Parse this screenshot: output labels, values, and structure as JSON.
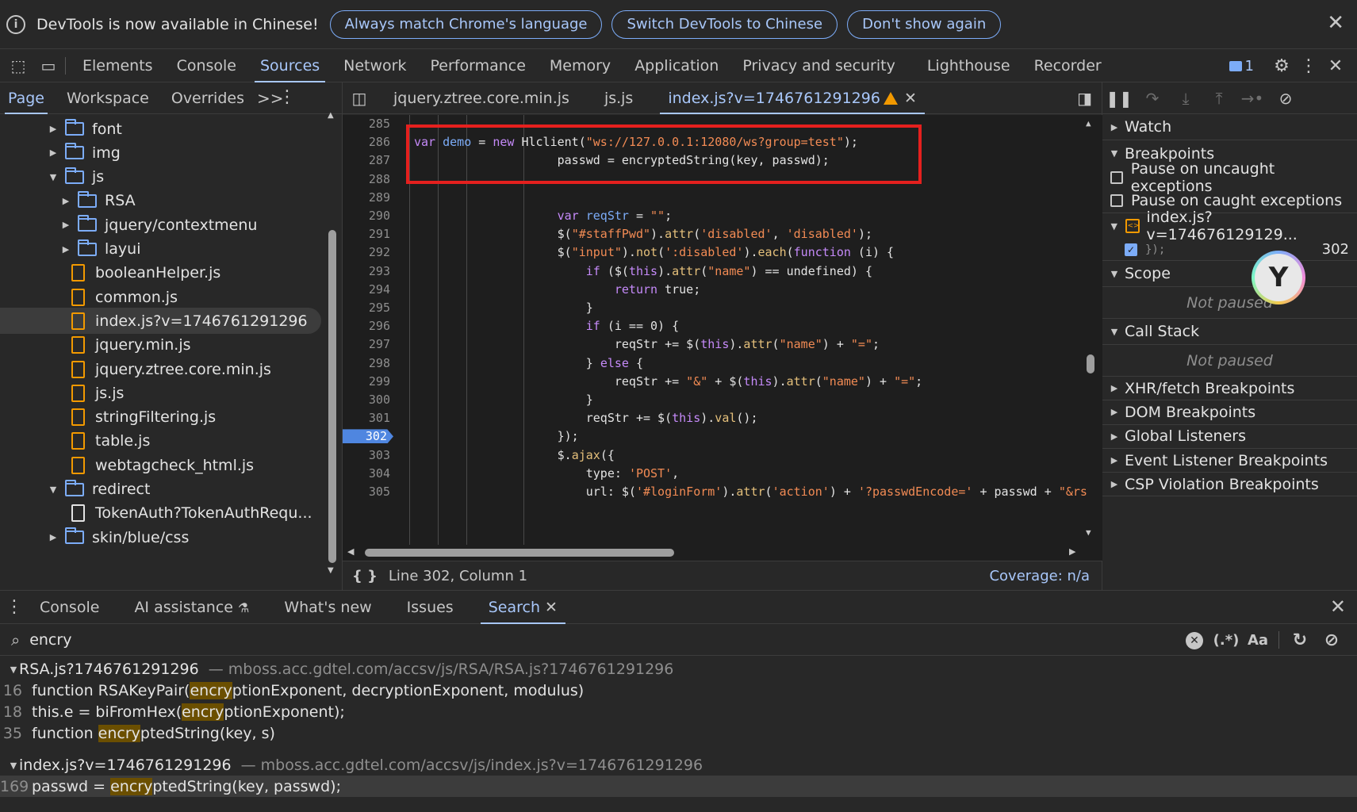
{
  "infobar": {
    "text": "DevTools is now available in Chinese!",
    "btn_match": "Always match Chrome's language",
    "btn_switch": "Switch DevTools to Chinese",
    "btn_dont": "Don't show again"
  },
  "toolbar": {
    "tabs": [
      "Elements",
      "Console",
      "Sources",
      "Network",
      "Performance",
      "Memory",
      "Application",
      "Privacy and security",
      "Lighthouse",
      "Recorder"
    ],
    "active_tab": "Sources",
    "issues_count": "1"
  },
  "navigator": {
    "tabs": [
      "Page",
      "Workspace",
      "Overrides"
    ],
    "more": ">>",
    "tree": [
      {
        "label": "font",
        "type": "folder",
        "depth": 1,
        "open": false
      },
      {
        "label": "img",
        "type": "folder",
        "depth": 1,
        "open": false
      },
      {
        "label": "js",
        "type": "folder",
        "depth": 1,
        "open": true
      },
      {
        "label": "RSA",
        "type": "folder",
        "depth": 2,
        "open": false
      },
      {
        "label": "jquery/contextmenu",
        "type": "folder",
        "depth": 2,
        "open": false
      },
      {
        "label": "layui",
        "type": "folder",
        "depth": 2,
        "open": false
      },
      {
        "label": "booleanHelper.js",
        "type": "file",
        "depth": 2
      },
      {
        "label": "common.js",
        "type": "file",
        "depth": 2
      },
      {
        "label": "index.js?v=1746761291296",
        "type": "file",
        "depth": 2,
        "selected": true
      },
      {
        "label": "jquery.min.js",
        "type": "file",
        "depth": 2
      },
      {
        "label": "jquery.ztree.core.min.js",
        "type": "file",
        "depth": 2
      },
      {
        "label": "js.js",
        "type": "file",
        "depth": 2
      },
      {
        "label": "stringFiltering.js",
        "type": "file",
        "depth": 2
      },
      {
        "label": "table.js",
        "type": "file",
        "depth": 2
      },
      {
        "label": "webtagcheck_html.js",
        "type": "file",
        "depth": 2
      },
      {
        "label": "redirect",
        "type": "folder",
        "depth": 1,
        "open": true
      },
      {
        "label": "TokenAuth?TokenAuthRequ...",
        "type": "doc",
        "depth": 2
      },
      {
        "label": "skin/blue/css",
        "type": "folder",
        "depth": 1,
        "open": false
      }
    ]
  },
  "editor": {
    "tabs": [
      "jquery.ztree.core.min.js",
      "js.js",
      "index.js?v=1746761291296"
    ],
    "active_tab": "index.js?v=1746761291296",
    "breakpoint_line": "302",
    "lines": [
      {
        "n": "285",
        "html": ""
      },
      {
        "n": "286",
        "html": "<span class=\"kw\">var</span> <span class=\"vr\">demo</span> = <span class=\"kw\">new</span> Hlclient(<span class=\"str\">\"ws://127.0.0.1:12080/ws?group=test\"</span>);"
      },
      {
        "n": "287",
        "html": "                    passwd = encryptedString(key, passwd);"
      },
      {
        "n": "288",
        "html": ""
      },
      {
        "n": "289",
        "html": ""
      },
      {
        "n": "290",
        "html": "                    <span class=\"kw\">var</span> <span class=\"vr\">reqStr</span> = <span class=\"str\">\"\"</span>;"
      },
      {
        "n": "291",
        "html": "                    $(<span class=\"str\">\"#staffPwd\"</span>).<span class=\"fn\">attr</span>(<span class=\"str\">'disabled'</span>, <span class=\"str\">'disabled'</span>);"
      },
      {
        "n": "292",
        "html": "                    $(<span class=\"str\">\"input\"</span>).<span class=\"fn\">not</span>(<span class=\"str\">':disabled'</span>).<span class=\"fn\">each</span>(<span class=\"kw\">function</span> (i) {"
      },
      {
        "n": "293",
        "html": "                        <span class=\"kw\">if</span> ($(<span class=\"th\">this</span>).<span class=\"fn\">attr</span>(<span class=\"str\">\"name\"</span>) == undefined) {"
      },
      {
        "n": "294",
        "html": "                            <span class=\"kw\">return</span> true;"
      },
      {
        "n": "295",
        "html": "                        }"
      },
      {
        "n": "296",
        "html": "                        <span class=\"kw\">if</span> (i == 0) {"
      },
      {
        "n": "297",
        "html": "                            reqStr += $(<span class=\"th\">this</span>).<span class=\"fn\">attr</span>(<span class=\"str\">\"name\"</span>) + <span class=\"str\">\"=\"</span>;"
      },
      {
        "n": "298",
        "html": "                        } <span class=\"kw\">else</span> {"
      },
      {
        "n": "299",
        "html": "                            reqStr += <span class=\"str\">\"&amp;\"</span> + $(<span class=\"th\">this</span>).<span class=\"fn\">attr</span>(<span class=\"str\">\"name\"</span>) + <span class=\"str\">\"=\"</span>;"
      },
      {
        "n": "300",
        "html": "                        }"
      },
      {
        "n": "301",
        "html": "                        reqStr += $(<span class=\"th\">this</span>).<span class=\"fn\">val</span>();"
      },
      {
        "n": "302",
        "html": "                    });"
      },
      {
        "n": "303",
        "html": "                    $.<span class=\"fn\">ajax</span>({"
      },
      {
        "n": "304",
        "html": "                        type: <span class=\"str\">'POST'</span>,"
      },
      {
        "n": "305",
        "html": "                        url: $(<span class=\"str\">'#loginForm'</span>).<span class=\"fn\">attr</span>(<span class=\"str\">'action'</span>) + <span class=\"str\">'?passwdEncode='</span> + passwd + <span class=\"str\">\"&amp;rs</span>"
      }
    ],
    "status_position": "Line 302, Column 1",
    "coverage": "Coverage: n/a"
  },
  "debugger": {
    "watch": "Watch",
    "breakpoints": "Breakpoints",
    "pause_uncaught": "Pause on uncaught exceptions",
    "pause_caught": "Pause on caught exceptions",
    "bp_file": "index.js?v=174676129129...",
    "bp_code": "});",
    "bp_line": "302",
    "scope": "Scope",
    "scope_state": "Not paused",
    "callstack": "Call Stack",
    "callstack_state": "Not paused",
    "sections": [
      "XHR/fetch Breakpoints",
      "DOM Breakpoints",
      "Global Listeners",
      "Event Listener Breakpoints",
      "CSP Violation Breakpoints"
    ]
  },
  "drawer": {
    "tabs": [
      "Console",
      "AI assistance",
      "What's new",
      "Issues",
      "Search"
    ],
    "active_tab": "Search",
    "search_value": "encry",
    "regex_label": "(.*)",
    "case_label": "Aa",
    "results": [
      {
        "file": "RSA.js?1746761291296",
        "path": "mboss.acc.gdtel.com/accsv/js/RSA/RSA.js?1746761291296",
        "lines": [
          {
            "n": "16",
            "pre": "function RSAKeyPair(",
            "hit": "encry",
            "post": "ptionExponent, decryptionExponent, modulus)"
          },
          {
            "n": "18",
            "pre": "this.e = biFromHex(",
            "hit": "encry",
            "post": "ptionExponent);"
          },
          {
            "n": "35",
            "pre": "function ",
            "hit": "encry",
            "post": "ptedString(key, s)"
          }
        ]
      },
      {
        "file": "index.js?v=1746761291296",
        "path": "mboss.acc.gdtel.com/accsv/js/index.js?v=1746761291296",
        "lines": [
          {
            "n": "169",
            "pre": "passwd = ",
            "hit": "encry",
            "post": "ptedString(key, passwd);"
          }
        ]
      }
    ]
  }
}
